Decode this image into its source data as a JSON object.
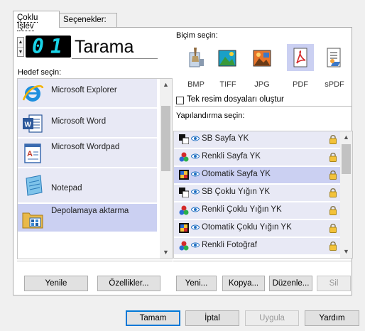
{
  "tabs": [
    {
      "label": "Çoklu İşlev",
      "active": true
    },
    {
      "label": "Seçenekler:",
      "active": false
    }
  ],
  "counter": {
    "digit1": "0",
    "digit2": "1",
    "title": "Tarama"
  },
  "destination": {
    "label": "Hedef seçin:",
    "items": [
      {
        "label": "Microsoft Explorer",
        "icon": "internet-explorer-icon",
        "selected": false
      },
      {
        "label": "Microsoft Word",
        "icon": "word-icon",
        "selected": false
      },
      {
        "label": "Microsoft Wordpad",
        "icon": "wordpad-icon",
        "selected": false
      },
      {
        "label": "Notepad",
        "icon": "notepad-icon",
        "selected": false
      },
      {
        "label": "Depolamaya aktarma",
        "icon": "storage-icon",
        "selected": true
      }
    ]
  },
  "format": {
    "label": "Biçim seçin:",
    "options": [
      {
        "label": "BMP",
        "icon": "bmp-icon",
        "selected": false
      },
      {
        "label": "TIFF",
        "icon": "tiff-icon",
        "selected": false
      },
      {
        "label": "JPG",
        "icon": "jpg-icon",
        "selected": false
      },
      {
        "label": "PDF",
        "icon": "pdf-icon",
        "selected": true
      },
      {
        "label": "sPDF",
        "icon": "spdf-icon",
        "selected": false
      }
    ],
    "single_image_label": "Tek resim dosyaları oluştur",
    "single_image_checked": false
  },
  "configuration": {
    "label": "Yapılandırma seçin:",
    "items": [
      {
        "label": "SB Sayfa YK",
        "mode": "bw",
        "selected": false
      },
      {
        "label": "Renkli Sayfa YK",
        "mode": "color",
        "selected": false
      },
      {
        "label": "Otomatik Sayfa YK",
        "mode": "auto",
        "selected": true
      },
      {
        "label": "SB Çoklu Yığın YK",
        "mode": "bw",
        "selected": false
      },
      {
        "label": "Renkli Çoklu Yığın YK",
        "mode": "color",
        "selected": false
      },
      {
        "label": "Otomatik Çoklu Yığın YK",
        "mode": "auto",
        "selected": false
      },
      {
        "label": "Renkli Fotoğraf",
        "mode": "color",
        "selected": false
      }
    ]
  },
  "buttons": {
    "refresh": "Yenile",
    "properties": "Özellikler...",
    "new": "Yeni...",
    "copy": "Kopya...",
    "edit": "Düzenle...",
    "delete": "Sil",
    "ok": "Tamam",
    "cancel": "İptal",
    "apply": "Uygula",
    "help": "Yardım"
  },
  "colors": {
    "selection": "#cbd0f2",
    "item_bg": "#e8e9f5",
    "lcd_digit": "#19d4e8",
    "default_button": "#0078d7"
  }
}
